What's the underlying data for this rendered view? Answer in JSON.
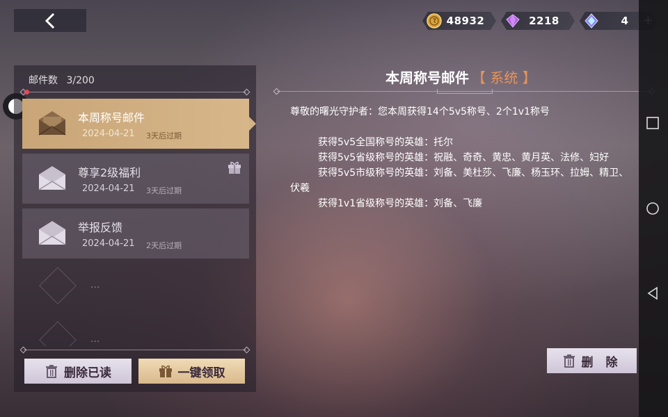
{
  "currencies": [
    {
      "name": "gold-coin",
      "value": "48932",
      "color": "#d9a440"
    },
    {
      "name": "purple-gem",
      "value": "2218",
      "color": "#b060e0"
    },
    {
      "name": "star-crystal",
      "value": "4",
      "color": "#9080f0"
    }
  ],
  "mail_list": {
    "count_label": "邮件数",
    "count_value": "3/200",
    "items": [
      {
        "title": "本周称号邮件",
        "date": "2024-04-21",
        "expiry": "3天后过期",
        "selected": true,
        "has_gift": false
      },
      {
        "title": "尊享2级福利",
        "date": "2024-04-21",
        "expiry": "3天后过期",
        "selected": false,
        "has_gift": true
      },
      {
        "title": "举报反馈",
        "date": "2024-04-21",
        "expiry": "2天后过期",
        "selected": false,
        "has_gift": false
      }
    ],
    "placeholder_text": "..."
  },
  "buttons": {
    "delete_read": "删除已读",
    "claim_all": "一键领取",
    "delete": "删 除"
  },
  "mail_detail": {
    "title": "本周称号邮件",
    "tag": "【 系统 】",
    "lines": [
      "尊敬的曙光守护者：您本周获得14个5v5称号、2个1v1称号",
      "获得5v5全国称号的英雄：托尔",
      "获得5v5省级称号的英雄：祝融、奇奇、黄忠、黄月英、法修、妇好",
      "获得5v5市级称号的英雄：刘备、美杜莎、飞廉、杨玉环、拉姆、精卫、伏羲",
      "获得1v1省级称号的英雄：刘备、飞廉"
    ]
  }
}
